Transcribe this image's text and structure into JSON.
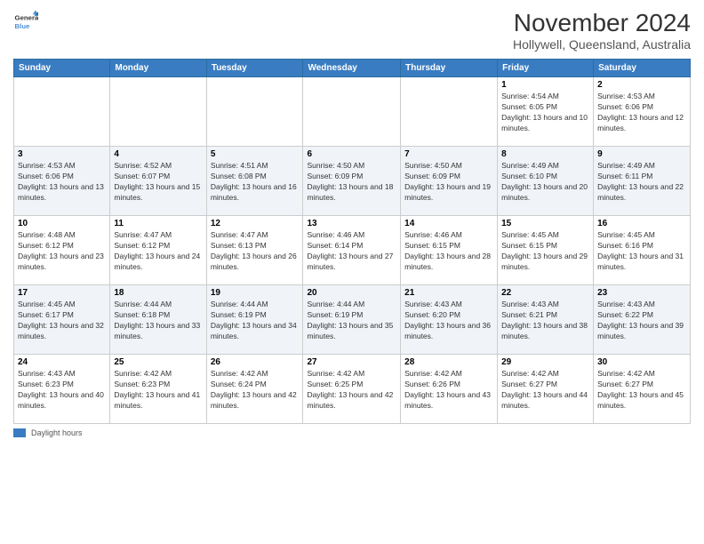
{
  "logo": {
    "line1": "General",
    "line2": "Blue"
  },
  "title": "November 2024",
  "subtitle": "Hollywell, Queensland, Australia",
  "days_header": [
    "Sunday",
    "Monday",
    "Tuesday",
    "Wednesday",
    "Thursday",
    "Friday",
    "Saturday"
  ],
  "weeks": [
    [
      {
        "day": "",
        "info": ""
      },
      {
        "day": "",
        "info": ""
      },
      {
        "day": "",
        "info": ""
      },
      {
        "day": "",
        "info": ""
      },
      {
        "day": "",
        "info": ""
      },
      {
        "day": "1",
        "info": "Sunrise: 4:54 AM\nSunset: 6:05 PM\nDaylight: 13 hours and 10 minutes."
      },
      {
        "day": "2",
        "info": "Sunrise: 4:53 AM\nSunset: 6:06 PM\nDaylight: 13 hours and 12 minutes."
      }
    ],
    [
      {
        "day": "3",
        "info": "Sunrise: 4:53 AM\nSunset: 6:06 PM\nDaylight: 13 hours and 13 minutes."
      },
      {
        "day": "4",
        "info": "Sunrise: 4:52 AM\nSunset: 6:07 PM\nDaylight: 13 hours and 15 minutes."
      },
      {
        "day": "5",
        "info": "Sunrise: 4:51 AM\nSunset: 6:08 PM\nDaylight: 13 hours and 16 minutes."
      },
      {
        "day": "6",
        "info": "Sunrise: 4:50 AM\nSunset: 6:09 PM\nDaylight: 13 hours and 18 minutes."
      },
      {
        "day": "7",
        "info": "Sunrise: 4:50 AM\nSunset: 6:09 PM\nDaylight: 13 hours and 19 minutes."
      },
      {
        "day": "8",
        "info": "Sunrise: 4:49 AM\nSunset: 6:10 PM\nDaylight: 13 hours and 20 minutes."
      },
      {
        "day": "9",
        "info": "Sunrise: 4:49 AM\nSunset: 6:11 PM\nDaylight: 13 hours and 22 minutes."
      }
    ],
    [
      {
        "day": "10",
        "info": "Sunrise: 4:48 AM\nSunset: 6:12 PM\nDaylight: 13 hours and 23 minutes."
      },
      {
        "day": "11",
        "info": "Sunrise: 4:47 AM\nSunset: 6:12 PM\nDaylight: 13 hours and 24 minutes."
      },
      {
        "day": "12",
        "info": "Sunrise: 4:47 AM\nSunset: 6:13 PM\nDaylight: 13 hours and 26 minutes."
      },
      {
        "day": "13",
        "info": "Sunrise: 4:46 AM\nSunset: 6:14 PM\nDaylight: 13 hours and 27 minutes."
      },
      {
        "day": "14",
        "info": "Sunrise: 4:46 AM\nSunset: 6:15 PM\nDaylight: 13 hours and 28 minutes."
      },
      {
        "day": "15",
        "info": "Sunrise: 4:45 AM\nSunset: 6:15 PM\nDaylight: 13 hours and 29 minutes."
      },
      {
        "day": "16",
        "info": "Sunrise: 4:45 AM\nSunset: 6:16 PM\nDaylight: 13 hours and 31 minutes."
      }
    ],
    [
      {
        "day": "17",
        "info": "Sunrise: 4:45 AM\nSunset: 6:17 PM\nDaylight: 13 hours and 32 minutes."
      },
      {
        "day": "18",
        "info": "Sunrise: 4:44 AM\nSunset: 6:18 PM\nDaylight: 13 hours and 33 minutes."
      },
      {
        "day": "19",
        "info": "Sunrise: 4:44 AM\nSunset: 6:19 PM\nDaylight: 13 hours and 34 minutes."
      },
      {
        "day": "20",
        "info": "Sunrise: 4:44 AM\nSunset: 6:19 PM\nDaylight: 13 hours and 35 minutes."
      },
      {
        "day": "21",
        "info": "Sunrise: 4:43 AM\nSunset: 6:20 PM\nDaylight: 13 hours and 36 minutes."
      },
      {
        "day": "22",
        "info": "Sunrise: 4:43 AM\nSunset: 6:21 PM\nDaylight: 13 hours and 38 minutes."
      },
      {
        "day": "23",
        "info": "Sunrise: 4:43 AM\nSunset: 6:22 PM\nDaylight: 13 hours and 39 minutes."
      }
    ],
    [
      {
        "day": "24",
        "info": "Sunrise: 4:43 AM\nSunset: 6:23 PM\nDaylight: 13 hours and 40 minutes."
      },
      {
        "day": "25",
        "info": "Sunrise: 4:42 AM\nSunset: 6:23 PM\nDaylight: 13 hours and 41 minutes."
      },
      {
        "day": "26",
        "info": "Sunrise: 4:42 AM\nSunset: 6:24 PM\nDaylight: 13 hours and 42 minutes."
      },
      {
        "day": "27",
        "info": "Sunrise: 4:42 AM\nSunset: 6:25 PM\nDaylight: 13 hours and 42 minutes."
      },
      {
        "day": "28",
        "info": "Sunrise: 4:42 AM\nSunset: 6:26 PM\nDaylight: 13 hours and 43 minutes."
      },
      {
        "day": "29",
        "info": "Sunrise: 4:42 AM\nSunset: 6:27 PM\nDaylight: 13 hours and 44 minutes."
      },
      {
        "day": "30",
        "info": "Sunrise: 4:42 AM\nSunset: 6:27 PM\nDaylight: 13 hours and 45 minutes."
      }
    ]
  ],
  "footer": {
    "daylight_label": "Daylight hours"
  }
}
